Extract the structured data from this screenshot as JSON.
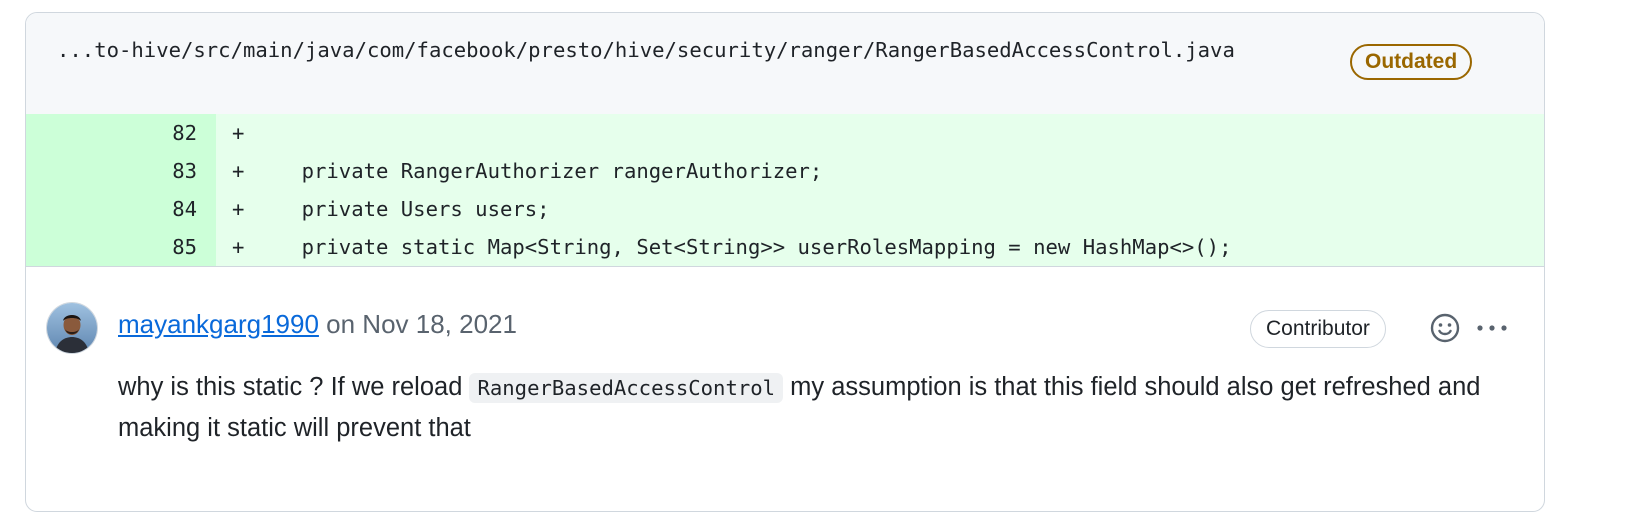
{
  "file": {
    "path": "...to-hive/src/main/java/com/facebook/presto/hive/security/ranger/RangerBasedAccessControl.java",
    "status_badge": "Outdated"
  },
  "diff": {
    "lines": [
      {
        "number": "82",
        "marker": "+",
        "code": ""
      },
      {
        "number": "83",
        "marker": "+",
        "code": "    private RangerAuthorizer rangerAuthorizer;"
      },
      {
        "number": "84",
        "marker": "+",
        "code": "    private Users users;"
      },
      {
        "number": "85",
        "marker": "+",
        "code": "    private static Map<String, Set<String>> userRolesMapping = new HashMap<>();"
      }
    ]
  },
  "comment": {
    "author": "mayankgarg1990",
    "date_text": " on Nov 18, 2021",
    "role_badge": "Contributor",
    "body_part1": "why is this static ? If we reload ",
    "body_code": "RangerBasedAccessControl",
    "body_part2": " my assumption is that this field should also get refreshed and making it static will prevent that"
  },
  "colors": {
    "addition_line_bg": "#e6ffec",
    "addition_num_bg": "#ccffd8",
    "outdated": "#9a6700",
    "link": "#0969da"
  },
  "icons": {
    "reaction": "smiley-icon",
    "more": "kebab-horizontal-icon"
  }
}
